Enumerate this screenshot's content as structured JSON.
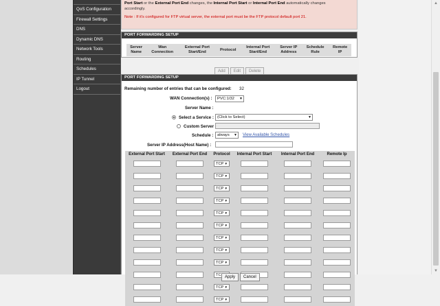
{
  "sidebar": {
    "items": [
      {
        "label": "QoS Configuration"
      },
      {
        "label": "Firewall Settings"
      },
      {
        "label": "DNS"
      },
      {
        "label": "Dynamic DNS"
      },
      {
        "label": "Network Tools"
      },
      {
        "label": "Routing"
      },
      {
        "label": "Schedules"
      },
      {
        "label": "IP Tunnel"
      },
      {
        "label": "Logout"
      }
    ]
  },
  "info": {
    "line1_a": "Port Start",
    "line1_b": " or the ",
    "line1_c": "External Port End",
    "line1_d": " changes, the ",
    "line1_e": "Internal Port Start",
    "line1_f": " or ",
    "line1_g": "Internal Port End",
    "line1_h": " automatically changes",
    "line2": "accordingly.",
    "note": "Note : If it's configured for FTP virtual server, the external port must be the FTP protocol default port 21."
  },
  "pf_list": {
    "header": "PORT FORWARDING SETUP",
    "columns": [
      [
        "Server",
        "Name"
      ],
      [
        "Wan",
        "Connection"
      ],
      [
        "External Port",
        "Start/End"
      ],
      [
        "Protocol",
        ""
      ],
      [
        "Internal Port",
        "Start/End"
      ],
      [
        "Server IP",
        "Address"
      ],
      [
        "Schedule",
        "Rule"
      ],
      [
        "Remote",
        "IP"
      ]
    ],
    "buttons": {
      "add": "Add",
      "edit": "Edit",
      "delete": "Delete"
    }
  },
  "pf_form": {
    "header": "PORT FORWARDING SETUP",
    "remaining_label": "Remaining number of entries that can be configured:",
    "remaining_value": "32",
    "wan_label": "WAN Connection(s) :",
    "wan_value": "PVC:1/32",
    "server_name_label": "Server Name :",
    "select_service_label": "Select a Service :",
    "service_value": "(Click to Select)",
    "custom_server_label": "Custom Server :",
    "schedule_label": "Schedule :",
    "schedule_value": "always",
    "view_schedules_link": "View Available Schedules",
    "server_ip_label": "Server IP Address(Host Name) :",
    "grid_columns": [
      "External Port Start",
      "External Port End",
      "Protocol",
      "Internal Port Start",
      "Internal Port End",
      "Remote Ip"
    ],
    "protocol_value": "TCP",
    "row_count": 12,
    "apply_label": "Apply",
    "cancel_label": "Cancel"
  },
  "icons": {
    "scroll_up": "scroll-up-arrow-icon",
    "scroll_down": "scroll-down-arrow-icon",
    "dropdown": "chevron-down-icon"
  }
}
